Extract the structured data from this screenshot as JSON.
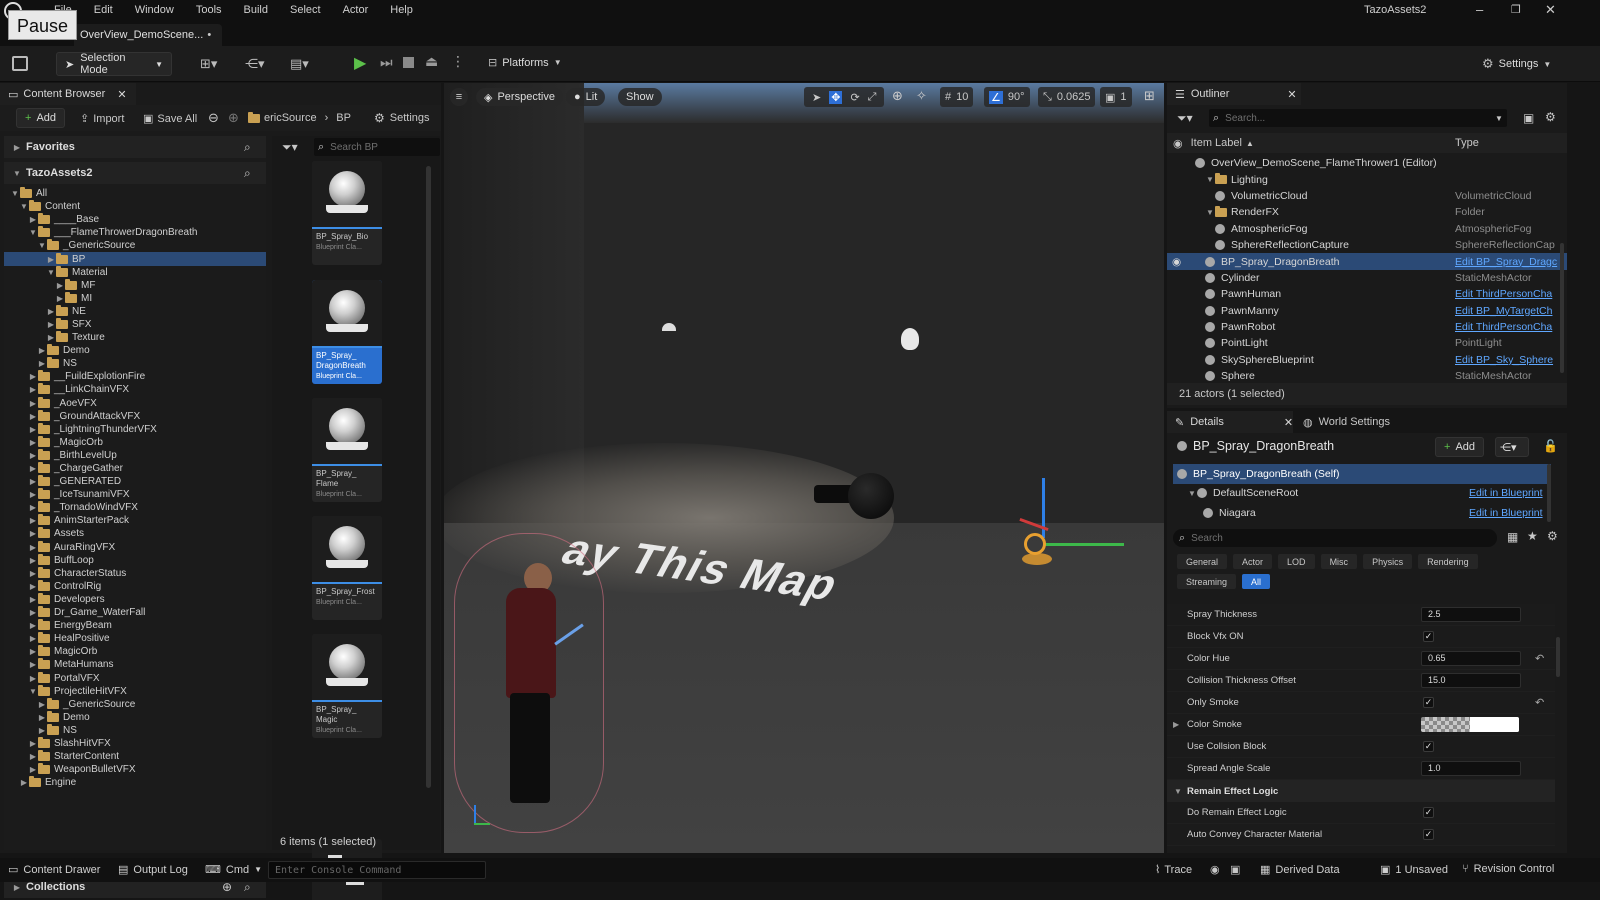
{
  "menu": [
    "File",
    "Edit",
    "Window",
    "Tools",
    "Build",
    "Select",
    "Actor",
    "Help"
  ],
  "pause_tooltip": "Pause",
  "project_name": "TazoAssets2",
  "level_tab": "OverView_DemoScene...",
  "toolbar": {
    "selection_mode": "Selection Mode",
    "platforms": "Platforms",
    "settings": "Settings"
  },
  "content_browser": {
    "tab": "Content Browser",
    "add": "Add",
    "import": "Import",
    "save_all": "Save All",
    "breadcrumb": [
      "ericSource",
      "BP"
    ],
    "settings": "Settings",
    "favorites": "Favorites",
    "root": "TazoAssets2",
    "search_placeholder": "Search BP",
    "tree": [
      {
        "label": "All",
        "depth": 0,
        "open": true
      },
      {
        "label": "Content",
        "depth": 1,
        "open": true
      },
      {
        "label": "____Base",
        "depth": 2
      },
      {
        "label": "___FlameThrowerDragonBreath",
        "depth": 2,
        "open": true
      },
      {
        "label": "_GenericSource",
        "depth": 3,
        "open": true
      },
      {
        "label": "BP",
        "depth": 4,
        "selected": true
      },
      {
        "label": "Material",
        "depth": 4,
        "open": true
      },
      {
        "label": "MF",
        "depth": 5
      },
      {
        "label": "MI",
        "depth": 5
      },
      {
        "label": "NE",
        "depth": 4
      },
      {
        "label": "SFX",
        "depth": 4
      },
      {
        "label": "Texture",
        "depth": 4
      },
      {
        "label": "Demo",
        "depth": 3
      },
      {
        "label": "NS",
        "depth": 3
      },
      {
        "label": "__FuildExplotionFire",
        "depth": 2
      },
      {
        "label": "__LinkChainVFX",
        "depth": 2
      },
      {
        "label": "_AoeVFX",
        "depth": 2
      },
      {
        "label": "_GroundAttackVFX",
        "depth": 2
      },
      {
        "label": "_LightningThunderVFX",
        "depth": 2
      },
      {
        "label": "_MagicOrb",
        "depth": 2
      },
      {
        "label": "_BirthLevelUp",
        "depth": 2
      },
      {
        "label": "_ChargeGather",
        "depth": 2
      },
      {
        "label": "_GENERATED",
        "depth": 2
      },
      {
        "label": "_IceTsunamiVFX",
        "depth": 2
      },
      {
        "label": "_TornadoWindVFX",
        "depth": 2
      },
      {
        "label": "AnimStarterPack",
        "depth": 2
      },
      {
        "label": "Assets",
        "depth": 2
      },
      {
        "label": "AuraRingVFX",
        "depth": 2
      },
      {
        "label": "BuffLoop",
        "depth": 2
      },
      {
        "label": "CharacterStatus",
        "depth": 2
      },
      {
        "label": "ControlRig",
        "depth": 2
      },
      {
        "label": "Developers",
        "depth": 2
      },
      {
        "label": "Dr_Game_WaterFall",
        "depth": 2
      },
      {
        "label": "EnergyBeam",
        "depth": 2
      },
      {
        "label": "HealPositive",
        "depth": 2
      },
      {
        "label": "MagicOrb",
        "depth": 2
      },
      {
        "label": "MetaHumans",
        "depth": 2
      },
      {
        "label": "PortalVFX",
        "depth": 2
      },
      {
        "label": "ProjectileHitVFX",
        "depth": 2,
        "open": true
      },
      {
        "label": "_GenericSource",
        "depth": 3
      },
      {
        "label": "Demo",
        "depth": 3
      },
      {
        "label": "NS",
        "depth": 3
      },
      {
        "label": "SlashHitVFX",
        "depth": 2
      },
      {
        "label": "StarterContent",
        "depth": 2
      },
      {
        "label": "WeaponBulletVFX",
        "depth": 2
      },
      {
        "label": "Engine",
        "depth": 1
      }
    ],
    "collections": "Collections",
    "item_count": "6 items (1 selected)",
    "assets": [
      {
        "name": "BP_Spray_Bio",
        "type": "Blueprint Cla..."
      },
      {
        "name": "BP_Spray_ DragonBreath",
        "type": "Blueprint Cla...",
        "selected": true
      },
      {
        "name": "BP_Spray_ Flame",
        "type": "Blueprint Cla..."
      },
      {
        "name": "BP_Spray_Frost",
        "type": "Blueprint Cla..."
      },
      {
        "name": "BP_Spray_ Magic",
        "type": "Blueprint Cla..."
      }
    ]
  },
  "viewport": {
    "perspective": "Perspective",
    "lit": "Lit",
    "show": "Show",
    "grid": "10",
    "angle": "90°",
    "scale": "0.0625",
    "camera": "1",
    "floor_text": "ay This Map"
  },
  "outliner": {
    "tab": "Outliner",
    "search_placeholder": "Search...",
    "col_label": "Item Label",
    "col_type": "Type",
    "rows": [
      {
        "label": "OverView_DemoScene_FlameThrower1 (Editor)",
        "type": "",
        "indent": 1
      },
      {
        "label": "Lighting",
        "type": "",
        "indent": 2,
        "folder": true
      },
      {
        "label": "VolumetricCloud",
        "type": "VolumetricCloud",
        "indent": 3
      },
      {
        "label": "RenderFX",
        "type": "Folder",
        "indent": 2,
        "folder": true
      },
      {
        "label": "AtmosphericFog",
        "type": "AtmosphericFog",
        "indent": 3
      },
      {
        "label": "SphereReflectionCapture",
        "type": "SphereReflectionCap",
        "indent": 3
      },
      {
        "label": "BP_Spray_DragonBreath",
        "type": "Edit BP_Spray_Dragc",
        "indent": 2,
        "link": true,
        "selected": true
      },
      {
        "label": "Cylinder",
        "type": "StaticMeshActor",
        "indent": 2
      },
      {
        "label": "PawnHuman",
        "type": "Edit ThirdPersonCha",
        "indent": 2,
        "link": true
      },
      {
        "label": "PawnManny",
        "type": "Edit BP_MyTargetCh",
        "indent": 2,
        "link": true
      },
      {
        "label": "PawnRobot",
        "type": "Edit ThirdPersonCha",
        "indent": 2,
        "link": true
      },
      {
        "label": "PointLight",
        "type": "PointLight",
        "indent": 2
      },
      {
        "label": "SkySphereBlueprint",
        "type": "Edit BP_Sky_Sphere",
        "indent": 2,
        "link": true
      },
      {
        "label": "Sphere",
        "type": "StaticMeshActor",
        "indent": 2
      }
    ],
    "count": "21 actors (1 selected)"
  },
  "details": {
    "tab": "Details",
    "world_tab": "World Settings",
    "object": "BP_Spray_DragonBreath",
    "add": "Add",
    "components": [
      {
        "label": "BP_Spray_DragonBreath (Self)",
        "link": "",
        "selected": true
      },
      {
        "label": "DefaultSceneRoot",
        "link": "Edit in Blueprint"
      },
      {
        "label": "Niagara",
        "link": "Edit in Blueprint"
      }
    ],
    "search_placeholder": "Search",
    "filters": [
      "General",
      "Actor",
      "LOD",
      "Misc",
      "Physics",
      "Rendering",
      "Streaming",
      "All"
    ],
    "props": [
      {
        "label": "Spray Thickness",
        "kind": "num",
        "value": "2.5"
      },
      {
        "label": "Block Vfx ON",
        "kind": "check"
      },
      {
        "label": "Color Hue",
        "kind": "num",
        "value": "0.65",
        "reset": true
      },
      {
        "label": "Collision Thickness Offset",
        "kind": "num",
        "value": "15.0"
      },
      {
        "label": "Only Smoke",
        "kind": "check",
        "reset": true
      },
      {
        "label": "Color Smoke",
        "kind": "color"
      },
      {
        "label": "Use Collsion Block",
        "kind": "check"
      },
      {
        "label": "Spread Angle Scale",
        "kind": "num",
        "value": "1.0"
      }
    ],
    "section": "Remain Effect Logic",
    "section_props": [
      {
        "label": "Do Remain Effect Logic",
        "kind": "check"
      },
      {
        "label": "Auto Convey Character Material",
        "kind": "check"
      }
    ]
  },
  "status": {
    "content_drawer": "Content Drawer",
    "output_log": "Output Log",
    "cmd": "Cmd",
    "console_placeholder": "Enter Console Command",
    "trace": "Trace",
    "derived_data": "Derived Data",
    "unsaved": "1 Unsaved",
    "revision": "Revision Control"
  }
}
